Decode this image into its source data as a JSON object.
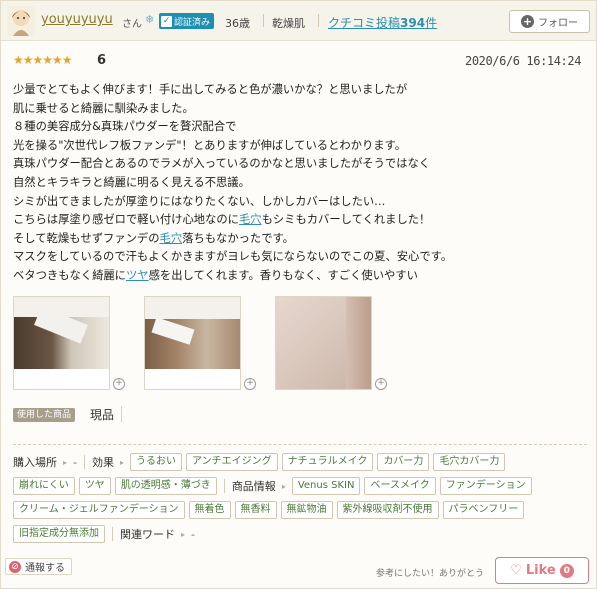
{
  "header": {
    "username": "youyuyuyu",
    "honorific": "さん",
    "verified_label": "認証済み",
    "age": "36歳",
    "skin_type": "乾燥肌",
    "posts_prefix": "クチコミ投稿",
    "posts_count": "394",
    "posts_suffix": "件",
    "follow_label": "フォロー"
  },
  "rating": {
    "stars": "★★★★★★",
    "score": "6"
  },
  "date": "2020/6/6 16:14:24",
  "review": {
    "l1": "少量でとてもよく伸びます！手に出してみると色が濃いかな？と思いましたが",
    "l2": "肌に乗せると綺麗に馴染みました。",
    "l3": "８種の美容成分&真珠パウダーを贅沢配合で",
    "l4": "光を操る\"次世代レフ板ファンデ\"！とありますが伸ばしているとわかります。",
    "l5": "真珠パウダー配合とあるのでラメが入っているのかなと思いましたがそうではなく",
    "l6": "自然とキラキラと綺麗に明るく見える不思議。",
    "l7": "シミが出てきましたが厚塗りにはなりたくない、しかしカバーはしたい…",
    "l8a": "こちらは厚塗り感ゼロで軽い付け心地なのに",
    "l8kw": "毛穴",
    "l8b": "もシミもカバーしてくれました！",
    "l9a": "そして乾燥もせずファンデの",
    "l9kw": "毛穴",
    "l9b": "落ちもなかったです。",
    "l10": "マスクをしているので汗もよくかきますがヨレも気にならないのでこの夏、安心です。",
    "l11a": "ベタつきもなく綺麗に",
    "l11kw": "ツヤ",
    "l11b": "感を出してくれます。香りもなく、すごく使いやすい"
  },
  "product": {
    "used_label": "使用した商品",
    "name": "現品"
  },
  "tags": {
    "purchase_label": "購入場所",
    "purchase_value": "-",
    "effect_label": "効果",
    "effects": [
      "うるおい",
      "アンチエイジング",
      "ナチュラルメイク",
      "カバー力",
      "毛穴カバー力",
      "崩れにくい",
      "ツヤ",
      "肌の透明感・薄づき"
    ],
    "product_info_label": "商品情報",
    "product_info": [
      "Venus SKIN",
      "ベースメイク",
      "ファンデーション",
      "クリーム・ジェルファンデーション",
      "無着色",
      "無香料",
      "無鉱物油",
      "紫外線吸収剤不使用",
      "パラベンフリー",
      "旧指定成分無添加"
    ],
    "related_label": "関連ワード",
    "related_value": "-"
  },
  "footer": {
    "report_label": "通報する",
    "helpful_text": "参考にしたい！ありがとう",
    "like_label": "Like",
    "like_count": "0"
  },
  "colors": {
    "accent_link": "#2b8fb0",
    "star": "#e6a52a",
    "like": "#e07b83",
    "tag_text": "#4a7a38"
  }
}
